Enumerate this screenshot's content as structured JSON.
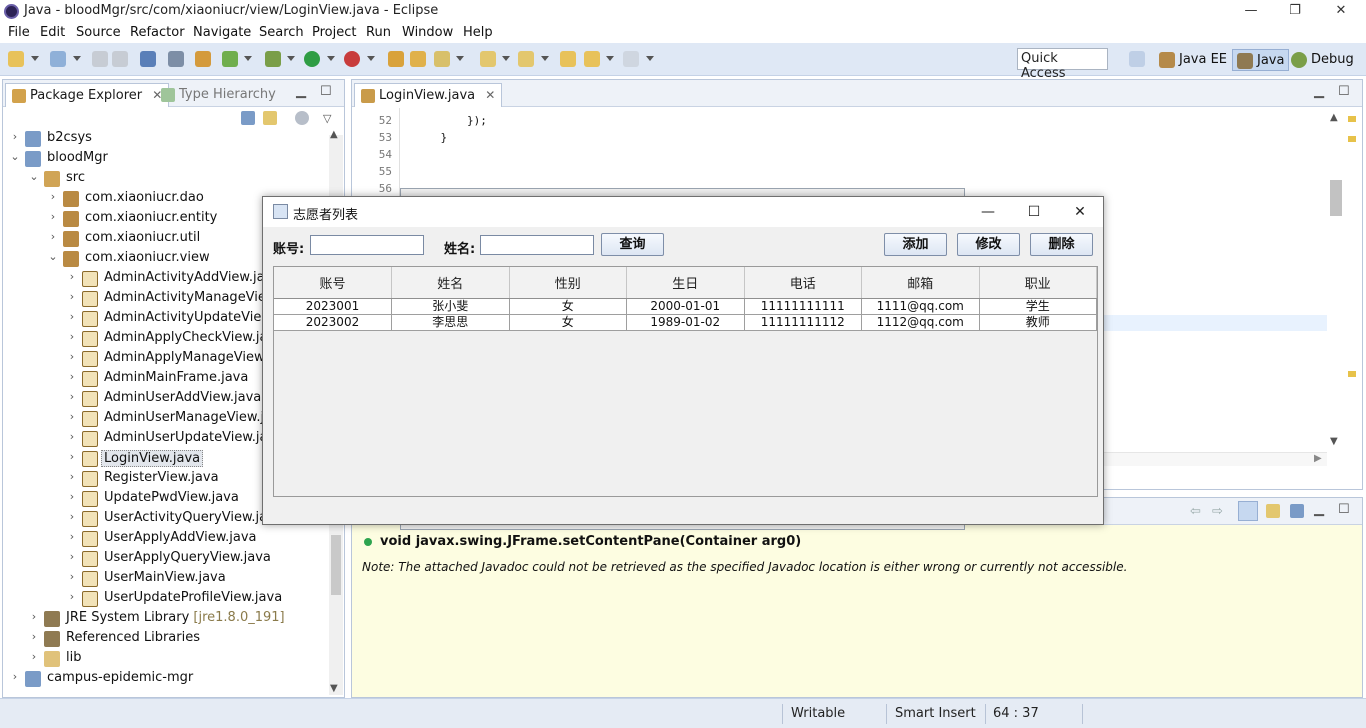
{
  "window": {
    "title": "Java - bloodMgr/src/com/xiaoniucr/view/LoginView.java - Eclipse",
    "controls": [
      "—",
      "❐",
      "✕"
    ]
  },
  "menu": [
    "File",
    "Edit",
    "Source",
    "Refactor",
    "Navigate",
    "Search",
    "Project",
    "Run",
    "Window",
    "Help"
  ],
  "toolbar": {
    "quick_access": "Quick Access",
    "perspectives": [
      "Java EE",
      "Java",
      "Debug"
    ]
  },
  "package_explorer": {
    "tabs": [
      "Package Explorer",
      "Type Hierarchy"
    ],
    "close_glyph": "✕",
    "items": [
      {
        "label": "b2csys",
        "decoration": ""
      },
      {
        "label": "bloodMgr",
        "decoration": ""
      },
      {
        "label": "src",
        "decoration": ""
      },
      {
        "label": "com.xiaoniucr.dao",
        "decoration": ""
      },
      {
        "label": "com.xiaoniucr.entity",
        "decoration": ""
      },
      {
        "label": "com.xiaoniucr.util",
        "decoration": ""
      },
      {
        "label": "com.xiaoniucr.view",
        "decoration": ""
      },
      {
        "label": "AdminActivityAddView.java",
        "decoration": ""
      },
      {
        "label": "AdminActivityManageView.java",
        "decoration": ""
      },
      {
        "label": "AdminActivityUpdateView.java",
        "decoration": ""
      },
      {
        "label": "AdminApplyCheckView.java",
        "decoration": ""
      },
      {
        "label": "AdminApplyManageView.java",
        "decoration": ""
      },
      {
        "label": "AdminMainFrame.java",
        "decoration": ""
      },
      {
        "label": "AdminUserAddView.java",
        "decoration": ""
      },
      {
        "label": "AdminUserManageView.java",
        "decoration": ""
      },
      {
        "label": "AdminUserUpdateView.java",
        "decoration": ""
      },
      {
        "label": "LoginView.java",
        "decoration": ""
      },
      {
        "label": "RegisterView.java",
        "decoration": ""
      },
      {
        "label": "UpdatePwdView.java",
        "decoration": ""
      },
      {
        "label": "UserActivityQueryView.java",
        "decoration": ""
      },
      {
        "label": "UserApplyAddView.java",
        "decoration": ""
      },
      {
        "label": "UserApplyQueryView.java",
        "decoration": ""
      },
      {
        "label": "UserMainView.java",
        "decoration": ""
      },
      {
        "label": "UserUpdateProfileView.java",
        "decoration": ""
      },
      {
        "label": "JRE System Library",
        "decoration": "[jre1.8.0_191]"
      },
      {
        "label": "Referenced Libraries",
        "decoration": ""
      },
      {
        "label": "lib",
        "decoration": ""
      },
      {
        "label": "campus-epidemic-mgr",
        "decoration": ""
      }
    ]
  },
  "editor": {
    "tab": "LoginView.java",
    "lines": [
      {
        "num": "52",
        "code": "        });"
      },
      {
        "num": "53",
        "code": "    }"
      },
      {
        "num": "54",
        "code": ""
      },
      {
        "num": "55",
        "code": ""
      },
      {
        "num": "56",
        "code": ""
      }
    ]
  },
  "javadoc": {
    "signature": "void javax.swing.JFrame.setContentPane(Container arg0)",
    "note": "Note: The attached Javadoc could not be retrieved as the specified Javadoc location is either wrong or currently not accessible."
  },
  "status": {
    "writable": "Writable",
    "insert_mode": "Smart Insert",
    "position": "64 : 37"
  },
  "dialog": {
    "title": "志愿者列表",
    "controls": [
      "—",
      "☐",
      "✕"
    ],
    "account_label": "账号:",
    "name_label": "姓名:",
    "account_value": "",
    "name_value": "",
    "query_button": "查询",
    "add_button": "添加",
    "edit_button": "修改",
    "delete_button": "删除",
    "table": {
      "columns": [
        "账号",
        "姓名",
        "性别",
        "生日",
        "电话",
        "邮箱",
        "职业"
      ],
      "rows": [
        [
          "2023001",
          "张小斐",
          "女",
          "2000-01-01",
          "11111111111",
          "1111@qq.com",
          "学生"
        ],
        [
          "2023002",
          "李思思",
          "女",
          "1989-01-02",
          "11111111112",
          "1112@qq.com",
          "教师"
        ]
      ]
    }
  }
}
